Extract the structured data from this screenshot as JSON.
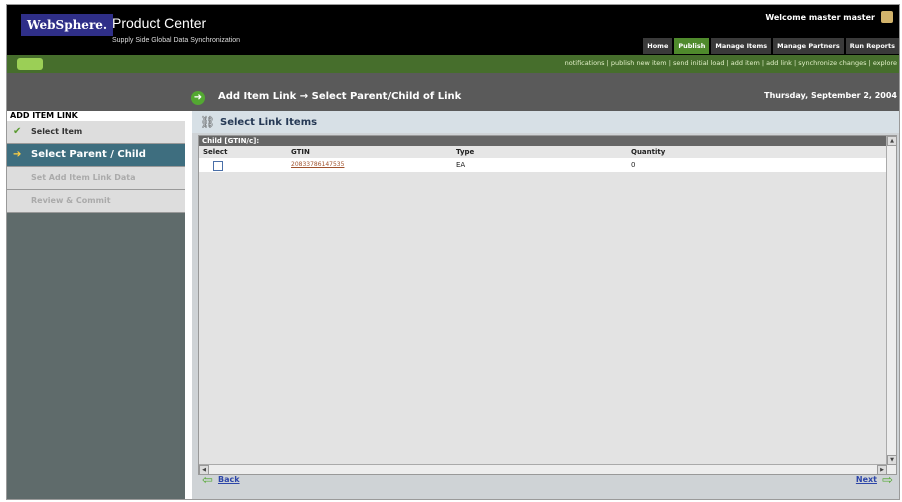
{
  "brand": {
    "logo_text": "WebSphere.",
    "product": "Product Center",
    "subtitle": "Supply Side Global Data Synchronization"
  },
  "header": {
    "welcome": "Welcome master master"
  },
  "main_tabs": [
    {
      "label": "Home"
    },
    {
      "label": "Publish"
    },
    {
      "label": "Manage Items"
    },
    {
      "label": "Manage Partners"
    },
    {
      "label": "Run Reports"
    }
  ],
  "sublinks": "notifications | publish new item | send initial load | add item | add link | synchronize changes | explore",
  "wizard": {
    "title": "Add Item Link → Select Parent/Child of Link",
    "date": "Thursday, September 2, 2004"
  },
  "sidebar": {
    "heading": "ADD ITEM LINK",
    "items": [
      {
        "label": "Select Item"
      },
      {
        "label": "Select Parent / Child"
      },
      {
        "label": "Set Add Item Link Data"
      },
      {
        "label": "Review & Commit"
      }
    ]
  },
  "content": {
    "section_title": "Select Link Items",
    "grid_caption": "Child [GTIN/c]:",
    "columns": {
      "select": "Select",
      "gtin": "GTIN",
      "type": "Type",
      "quantity": "Quantity"
    },
    "rows": [
      {
        "gtin": "20833786147535",
        "type": "EA",
        "quantity": "0"
      }
    ]
  },
  "nav": {
    "back": "Back",
    "next": "Next"
  },
  "colors": {
    "header_bg": "#000000",
    "green_bar": "#466e2c",
    "active_step": "#3e6e7f",
    "link": "#a0522d"
  }
}
